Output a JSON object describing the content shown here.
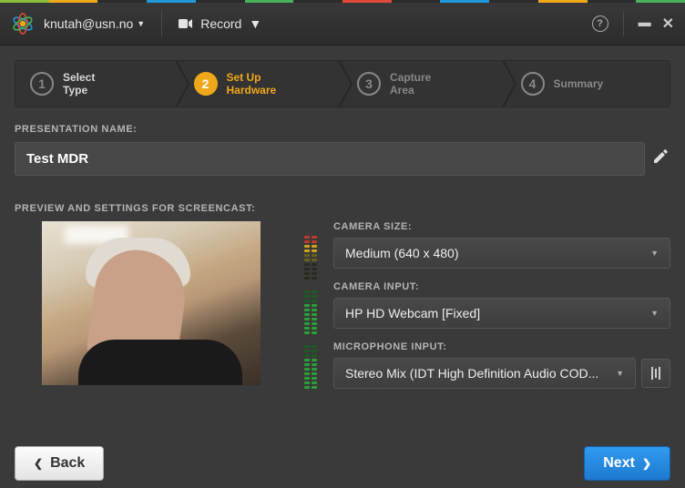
{
  "colors": {
    "accent": "#f0a81a",
    "primary": "#2f9af0"
  },
  "color_strip": [
    "#8bbf3a",
    "#f0a81a",
    "#2c2c2c",
    "#2196d8",
    "#2c2c2c",
    "#48b05a",
    "#2c2c2c",
    "#e04a3a",
    "#2c2c2c",
    "#2196d8",
    "#2c2c2c",
    "#f0a81a",
    "#2c2c2c",
    "#48b05a"
  ],
  "topbar": {
    "user": "knutah@usn.no",
    "record": "Record"
  },
  "wizard": [
    {
      "num": "1",
      "line1": "Select",
      "line2": "Type"
    },
    {
      "num": "2",
      "line1": "Set Up",
      "line2": "Hardware"
    },
    {
      "num": "3",
      "line1": "Capture",
      "line2": "Area"
    },
    {
      "num": "4",
      "line1": "Summary",
      "line2": ""
    }
  ],
  "labels": {
    "presentation_name": "PRESENTATION NAME:",
    "preview_section": "PREVIEW AND SETTINGS FOR SCREENCAST:",
    "camera_size": "CAMERA SIZE:",
    "camera_input": "CAMERA INPUT:",
    "microphone_input": "MICROPHONE INPUT:"
  },
  "values": {
    "name": "Test MDR",
    "camera_size": "Medium (640 x 480)",
    "camera_input": "HP HD Webcam [Fixed]",
    "microphone_input": "Stereo Mix (IDT High Definition Audio COD..."
  },
  "buttons": {
    "back": "Back",
    "next": "Next"
  }
}
